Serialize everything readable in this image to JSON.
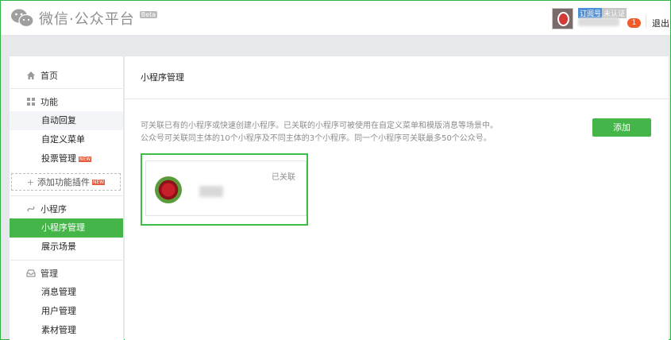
{
  "header": {
    "logo_text": "微信·公众平台",
    "beta": "Beta",
    "account_type": "订阅号",
    "verify_status": "未认证",
    "notification_count": "1",
    "logout": "退出"
  },
  "sidebar": {
    "home": "首页",
    "features": {
      "title": "功能",
      "items": [
        "自动回复",
        "自定义菜单",
        "投票管理"
      ],
      "new_tag": "NEW",
      "add_plugin": "添加功能插件"
    },
    "miniprogram": {
      "title": "小程序",
      "items": [
        "小程序管理",
        "展示场景"
      ]
    },
    "management": {
      "title": "管理",
      "items": [
        "消息管理",
        "用户管理",
        "素材管理"
      ]
    }
  },
  "main": {
    "title": "小程序管理",
    "desc_line1": "可关联已有的小程序或快速创建小程序。已关联的小程序可被使用在自定义菜单和模版消息等场景中。",
    "desc_line2": "公众号可关联同主体的10个小程序及不同主体的3个小程序。同一个小程序可关联最多50个公众号。",
    "add_button": "添加",
    "card": {
      "status": "已关联"
    }
  },
  "colors": {
    "accent": "#44b549",
    "highlight_border": "#3dbf47",
    "badge": "#f25a29"
  },
  "icons": [
    "wechat-logo-icon",
    "home-icon",
    "grid-icon",
    "link-icon",
    "inbox-icon",
    "plus-icon"
  ]
}
